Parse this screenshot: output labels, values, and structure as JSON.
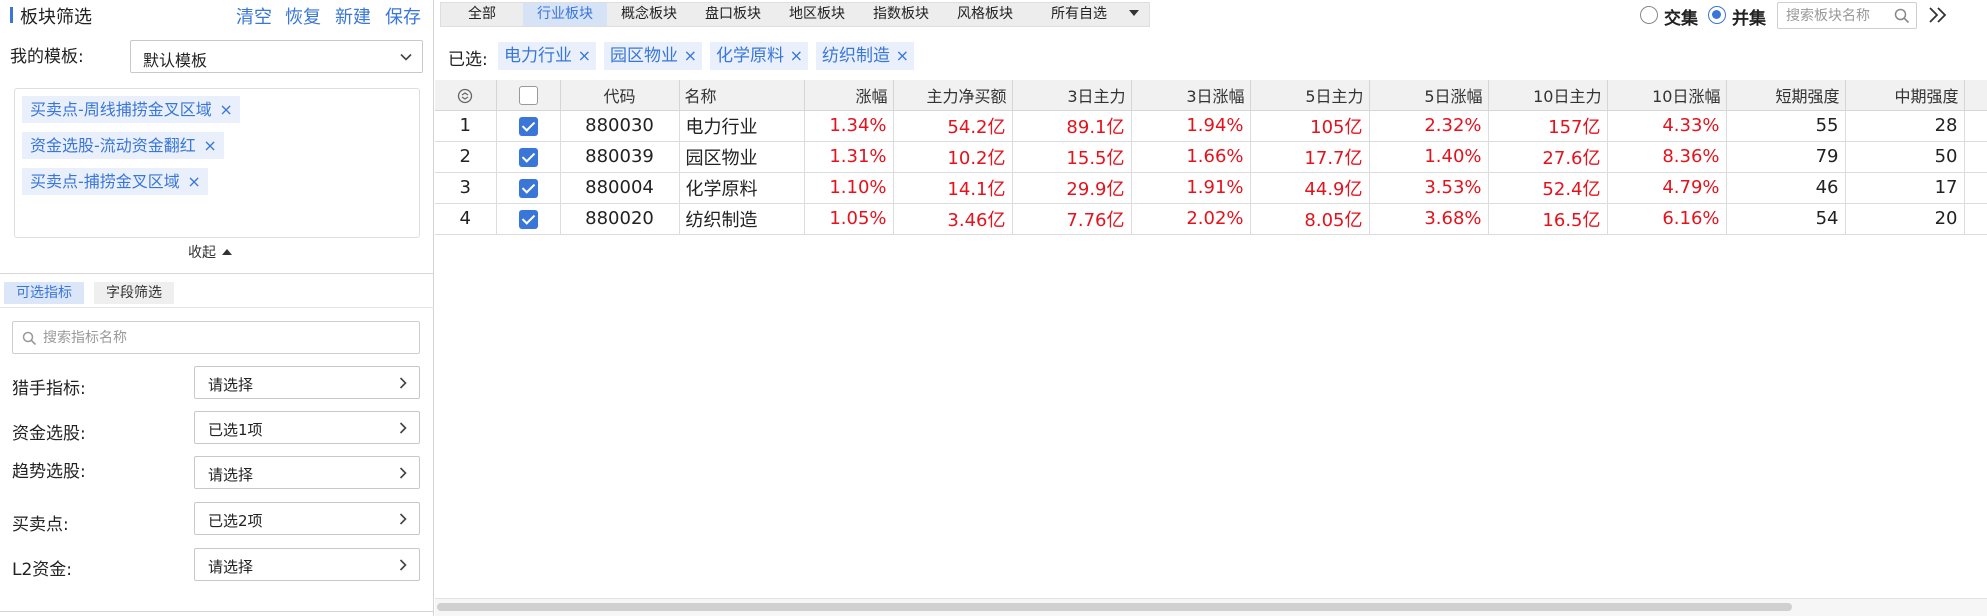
{
  "left": {
    "title": "板块筛选",
    "actions": [
      "清空",
      "恢复",
      "新建",
      "保存"
    ],
    "template_label": "我的模板:",
    "template_value": "默认模板",
    "template_tags": [
      "买卖点-周线捕捞金叉区域",
      "资金选股-流动资金翻红",
      "买卖点-捕捞金叉区域"
    ],
    "tag_close": "×",
    "collapse_label": "收起",
    "subtabs": [
      "可选指标",
      "字段筛选"
    ],
    "indicator_search_placeholder": "搜索指标名称",
    "indicators": [
      {
        "label": "猎手指标:",
        "value": "请选择"
      },
      {
        "label": "资金选股:",
        "value": "已选1项"
      },
      {
        "label": "趋势选股:",
        "value": "请选择"
      },
      {
        "label": "买卖点:",
        "value": "已选2项"
      },
      {
        "label": "L2资金:",
        "value": "请选择"
      }
    ]
  },
  "right": {
    "tabs": [
      "全部",
      "行业板块",
      "概念板块",
      "盘口板块",
      "地区板块",
      "指数板块",
      "风格板块",
      "所有自选"
    ],
    "active_tab": "行业板块",
    "radios": [
      {
        "label": "交集",
        "checked": false
      },
      {
        "label": "并集",
        "checked": true
      }
    ],
    "sector_search_placeholder": "搜索板块名称",
    "selected_label": "已选:",
    "selected_tags": [
      "电力行业",
      "园区物业",
      "化学原料",
      "纺织制造"
    ],
    "tag_close": "×",
    "table": {
      "columns": [
        "代码",
        "名称",
        "涨幅",
        "主力净买额",
        "3日主力",
        "3日涨幅",
        "5日主力",
        "5日涨幅",
        "10日主力",
        "10日涨幅",
        "短期强度",
        "中期强度"
      ],
      "rows": [
        {
          "idx": "1",
          "checked": true,
          "code": "880030",
          "name": "电力行业",
          "chg": "1.34%",
          "net": "54.2亿",
          "m3": "89.1亿",
          "c3": "1.94%",
          "m5": "105亿",
          "c5": "2.32%",
          "m10": "157亿",
          "c10": "4.33%",
          "short": "55",
          "mid": "28"
        },
        {
          "idx": "2",
          "checked": true,
          "code": "880039",
          "name": "园区物业",
          "chg": "1.31%",
          "net": "10.2亿",
          "m3": "15.5亿",
          "c3": "1.66%",
          "m5": "17.7亿",
          "c5": "1.40%",
          "m10": "27.6亿",
          "c10": "8.36%",
          "short": "79",
          "mid": "50"
        },
        {
          "idx": "3",
          "checked": true,
          "code": "880004",
          "name": "化学原料",
          "chg": "1.10%",
          "net": "14.1亿",
          "m3": "29.9亿",
          "c3": "1.91%",
          "m5": "44.9亿",
          "c5": "3.53%",
          "m10": "52.4亿",
          "c10": "4.79%",
          "short": "46",
          "mid": "17"
        },
        {
          "idx": "4",
          "checked": true,
          "code": "880020",
          "name": "纺织制造",
          "chg": "1.05%",
          "net": "3.46亿",
          "m3": "7.76亿",
          "c3": "2.02%",
          "m5": "8.05亿",
          "c5": "3.68%",
          "m10": "16.5亿",
          "c10": "6.16%",
          "short": "54",
          "mid": "20"
        }
      ]
    }
  },
  "colors": {
    "accent": "#3a76d8",
    "up": "#e5121c",
    "tag_bg": "#e9f0fb"
  }
}
